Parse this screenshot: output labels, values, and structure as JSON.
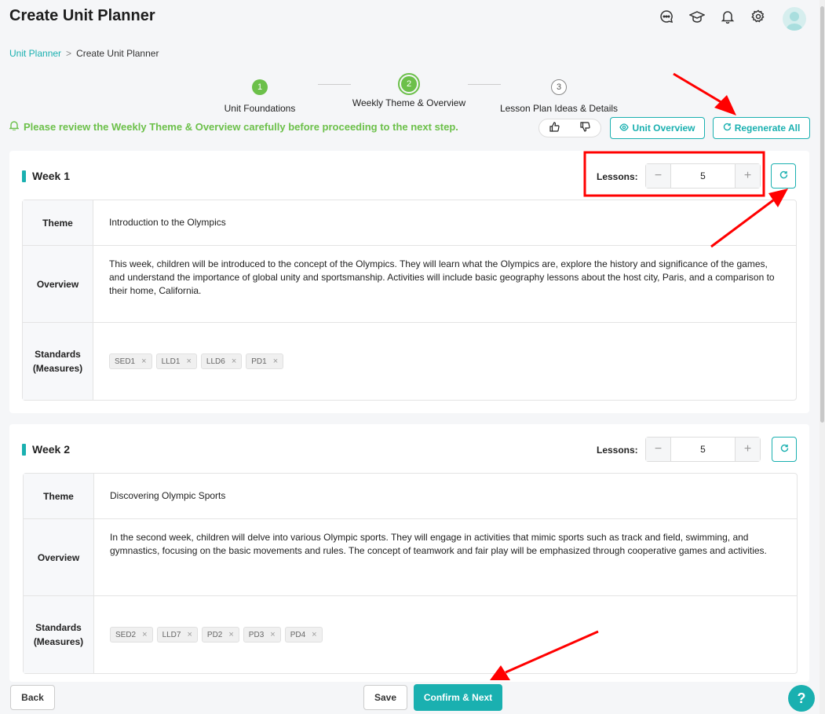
{
  "header": {
    "title": "Create Unit Planner",
    "icons": [
      "chat-icon",
      "graduation-cap-icon",
      "bell-icon",
      "gear-icon"
    ]
  },
  "breadcrumb": {
    "parent": "Unit Planner",
    "separator": ">",
    "current": "Create Unit Planner"
  },
  "steps": [
    {
      "number": "1",
      "label": "Unit Foundations",
      "state": "completed"
    },
    {
      "number": "2",
      "label": "Weekly Theme & Overview",
      "state": "current"
    },
    {
      "number": "3",
      "label": "Lesson Plan Ideas & Details",
      "state": "pending"
    }
  ],
  "notice": {
    "text": "Please review the Weekly Theme & Overview carefully before proceeding to the next step.",
    "color": "#6cc04a"
  },
  "actions": {
    "unit_overview": "Unit Overview",
    "regenerate_all": "Regenerate All"
  },
  "weeks": [
    {
      "title": "Week 1",
      "lessons_label": "Lessons:",
      "lessons": "5",
      "theme_label": "Theme",
      "theme": "Introduction to the Olympics",
      "overview_label": "Overview",
      "overview": "This week, children will be introduced to the concept of the Olympics. They will learn what the Olympics are, explore the history and significance of the games, and understand the importance of global unity and sportsmanship. Activities will include basic geography lessons about the host city, Paris, and a comparison to their home, California.",
      "standards_label_1": "Standards",
      "standards_label_2": "(Measures)",
      "standards": [
        "SED1",
        "LLD1",
        "LLD6",
        "PD1"
      ]
    },
    {
      "title": "Week 2",
      "lessons_label": "Lessons:",
      "lessons": "5",
      "theme_label": "Theme",
      "theme": "Discovering Olympic Sports",
      "overview_label": "Overview",
      "overview": "In the second week, children will delve into various Olympic sports. They will engage in activities that mimic sports such as track and field, swimming, and gymnastics, focusing on the basic movements and rules. The concept of teamwork and fair play will be emphasized through cooperative games and activities.",
      "standards_label_1": "Standards",
      "standards_label_2": "(Measures)",
      "standards": [
        "SED2",
        "LLD7",
        "PD2",
        "PD3",
        "PD4"
      ]
    }
  ],
  "footer": {
    "back": "Back",
    "save": "Save",
    "confirm": "Confirm & Next",
    "help": "?"
  },
  "colors": {
    "accent": "#1ab0b0",
    "success": "#6cc04a",
    "annotation": "#ff0000"
  }
}
